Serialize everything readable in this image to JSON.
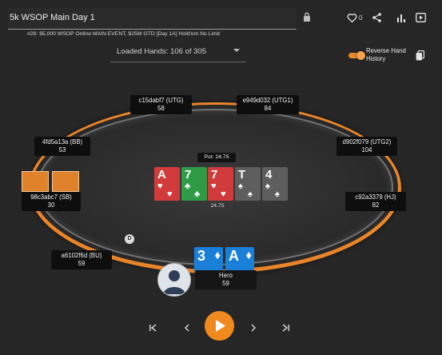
{
  "header": {
    "title": "5k WSOP Main Day 1",
    "subtitle": "#28: $5,000 WSOP Online MAIN EVENT, $25M GTD [Day 1A] Hold'em No Limit",
    "likes": "0"
  },
  "loaded_hands": {
    "label": "Loaded Hands: 106 of 305"
  },
  "reverse_toggle": {
    "label_line1": "Reverse Hand",
    "label_line2": "History",
    "on": true
  },
  "accent_color": "#e8892c",
  "seats": [
    {
      "id": "c15dabf7",
      "name": "c15dabf7 (UTG)",
      "stack": "58"
    },
    {
      "id": "e949d032",
      "name": "e949d032 (UTG1)",
      "stack": "84"
    },
    {
      "id": "4fd5a13a",
      "name": "4fd5a13a (BB)",
      "stack": "53"
    },
    {
      "id": "d902f079",
      "name": "d902f079 (UTG2)",
      "stack": "104"
    },
    {
      "id": "98c3abc7",
      "name": "98c3abc7 (SB)",
      "stack": "30"
    },
    {
      "id": "c92a3379",
      "name": "c92a3379 (HJ)",
      "stack": "82"
    },
    {
      "id": "a6102f6d",
      "name": "a6102f6d (BU)",
      "stack": "59"
    },
    {
      "id": "hero",
      "name": "Hero",
      "stack": "59"
    }
  ],
  "pot": {
    "label": "Pot: 24.75",
    "amount": "24.75"
  },
  "board": [
    {
      "rank": "A",
      "suit": "heart",
      "color": "#d23b3b"
    },
    {
      "rank": "7",
      "suit": "club",
      "color": "#2f9b46"
    },
    {
      "rank": "7",
      "suit": "heart",
      "color": "#d23b3b"
    },
    {
      "rank": "T",
      "suit": "spade",
      "color": "#5e5e5e"
    },
    {
      "rank": "4",
      "suit": "spade",
      "color": "#5e5e5e"
    }
  ],
  "hero_cards": [
    {
      "rank": "3",
      "suit": "diamond",
      "color": "#1a7fd6"
    },
    {
      "rank": "A",
      "suit": "diamond",
      "color": "#1a7fd6"
    }
  ],
  "dealer_button": "D",
  "icons": [
    "lock-icon",
    "heart-icon",
    "share-icon",
    "bar-chart-icon",
    "play-box-icon",
    "copy-icon",
    "first-icon",
    "prev-icon",
    "play-icon",
    "next-icon",
    "last-icon"
  ]
}
